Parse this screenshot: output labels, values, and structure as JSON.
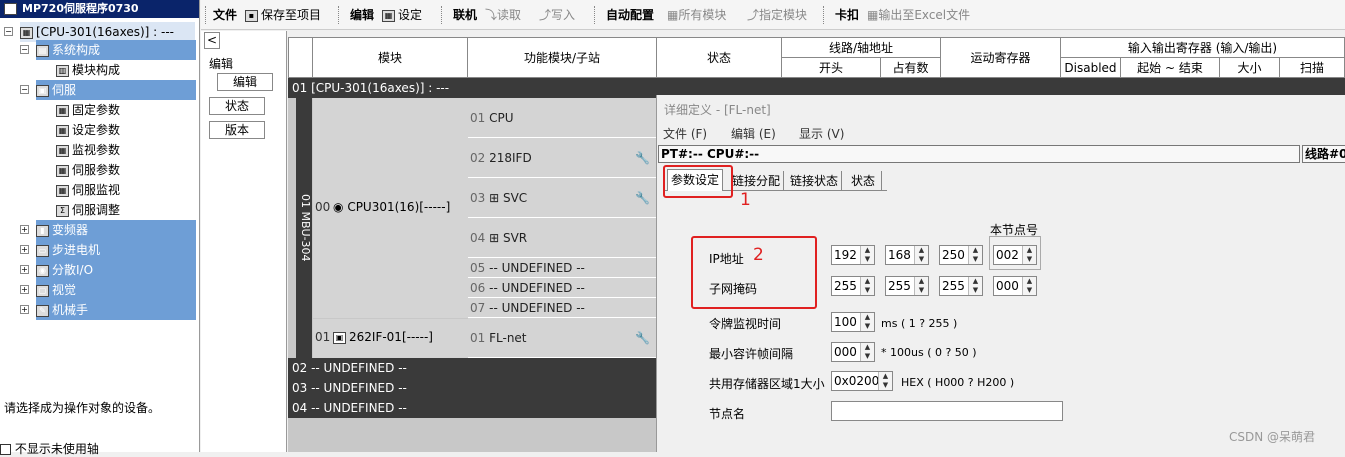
{
  "tree": {
    "title": "MP720伺服程序0730",
    "items": [
      {
        "pm": "⊟",
        "icon": "▦",
        "label": "[CPU-301(16axes)] : ---",
        "style": "sel"
      },
      {
        "pm": "⊟",
        "icon": "▤",
        "label": "系统构成",
        "style": "band"
      },
      {
        "pm": "",
        "icon": "▥",
        "label": "模块构成",
        "style": ""
      },
      {
        "pm": "⊟",
        "icon": "▣",
        "label": "伺服",
        "style": "band"
      },
      {
        "pm": "",
        "icon": "▦",
        "label": "固定参数",
        "style": ""
      },
      {
        "pm": "",
        "icon": "▦",
        "label": "设定参数",
        "style": ""
      },
      {
        "pm": "",
        "icon": "▦",
        "label": "监视参数",
        "style": ""
      },
      {
        "pm": "",
        "icon": "▦",
        "label": "伺服参数",
        "style": ""
      },
      {
        "pm": "",
        "icon": "▦",
        "label": "伺服监视",
        "style": ""
      },
      {
        "pm": "",
        "icon": "Σ",
        "label": "伺服调整",
        "style": ""
      },
      {
        "pm": "⊞",
        "icon": "▮",
        "label": "变频器",
        "style": "band"
      },
      {
        "pm": "⊞",
        "icon": "▭",
        "label": "步进电机",
        "style": "band"
      },
      {
        "pm": "⊞",
        "icon": "◉",
        "label": "分散I/O",
        "style": "band"
      },
      {
        "pm": "⊞",
        "icon": "▢",
        "label": "视觉",
        "style": "band"
      },
      {
        "pm": "⊞",
        "icon": "✎",
        "label": "机械手",
        "style": "band"
      }
    ],
    "status_text": "请选择成为操作对象的设备。",
    "footer_checkbox": "不显示未使用轴"
  },
  "toolbar": {
    "file": "文件",
    "save_project": "保存至项目",
    "edit": "编辑",
    "settings": "设定",
    "online": "联机",
    "read": "读取",
    "write": "写入",
    "auto_config": "自动配置",
    "all_modules": "所有模块",
    "specify_module": "指定模块",
    "card": "卡扣",
    "export_excel": "输出至Excel文件"
  },
  "left_pane": {
    "collapse": "<",
    "group_label": "编辑",
    "btn_edit": "编辑",
    "btn_status": "状态",
    "btn_version": "版本"
  },
  "grid": {
    "headers": {
      "module": "模块",
      "function_module": "功能模块/子站",
      "status": "状态",
      "line_addr": "线路/轴地址",
      "head": "开头",
      "occupied": "占有数",
      "motion_reg": "运动寄存器",
      "io_reg": "输入输出寄存器 (输入/输出)",
      "disabled": "Disabled",
      "start_end": "起始 ~ 结束",
      "size": "大小",
      "scan": "扫描"
    },
    "cpu_row": "01 [CPU-301(16axes)] : ---",
    "rack_label": "01 MBU-304",
    "cpu_slot": "00",
    "cpu_name": "CPU301(16)[-----]",
    "if_slot": "01",
    "if_name": "262IF-01[-----]",
    "slots": [
      {
        "num": "01",
        "name": "CPU",
        "plus": false,
        "wrench": false
      },
      {
        "num": "02",
        "name": "218IFD",
        "plus": false,
        "wrench": true
      },
      {
        "num": "03",
        "name": "SVC",
        "plus": true,
        "wrench": true
      },
      {
        "num": "04",
        "name": "SVR",
        "plus": true,
        "wrench": false
      },
      {
        "num": "05",
        "name": "-- UNDEFINED --",
        "plus": false,
        "wrench": false
      },
      {
        "num": "06",
        "name": "-- UNDEFINED --",
        "plus": false,
        "wrench": false
      },
      {
        "num": "07",
        "name": "-- UNDEFINED --",
        "plus": false,
        "wrench": false
      },
      {
        "num": "01",
        "name": "FL-net",
        "plus": false,
        "wrench": true
      }
    ],
    "undefined_rows": [
      "02 -- UNDEFINED --",
      "03 -- UNDEFINED --",
      "04 -- UNDEFINED --"
    ]
  },
  "dialog": {
    "title": "详细定义 - [FL-net]",
    "menu": {
      "file": "文件 (F)",
      "edit": "编辑 (E)",
      "view": "显示 (V)"
    },
    "pt_bar": "PT#:-- CPU#:--",
    "line_label": "线路#0",
    "tabs": [
      "参数设定",
      "链接分配",
      "链接状态",
      "状态"
    ],
    "annot1": "1",
    "annot2": "2",
    "node_no_label": "本节点号",
    "ip_label": "IP地址",
    "ip": [
      "192",
      "168",
      "250",
      "002"
    ],
    "subnet_label": "子网掩码",
    "subnet": [
      "255",
      "255",
      "255",
      "000"
    ],
    "token_label": "令牌监视时间",
    "token_value": "100",
    "token_unit": "ms ( 1 ? 255 )",
    "frame_label": "最小容许帧间隔",
    "frame_value": "000",
    "frame_unit": "* 100us ( 0 ? 50 )",
    "shared_label": "共用存储器区域1大小",
    "shared_value": "0x0200",
    "shared_unit": "HEX ( H000 ? H200 )",
    "node_name_label": "节点名",
    "node_name_value": ""
  },
  "watermark": "CSDN @呆萌君"
}
